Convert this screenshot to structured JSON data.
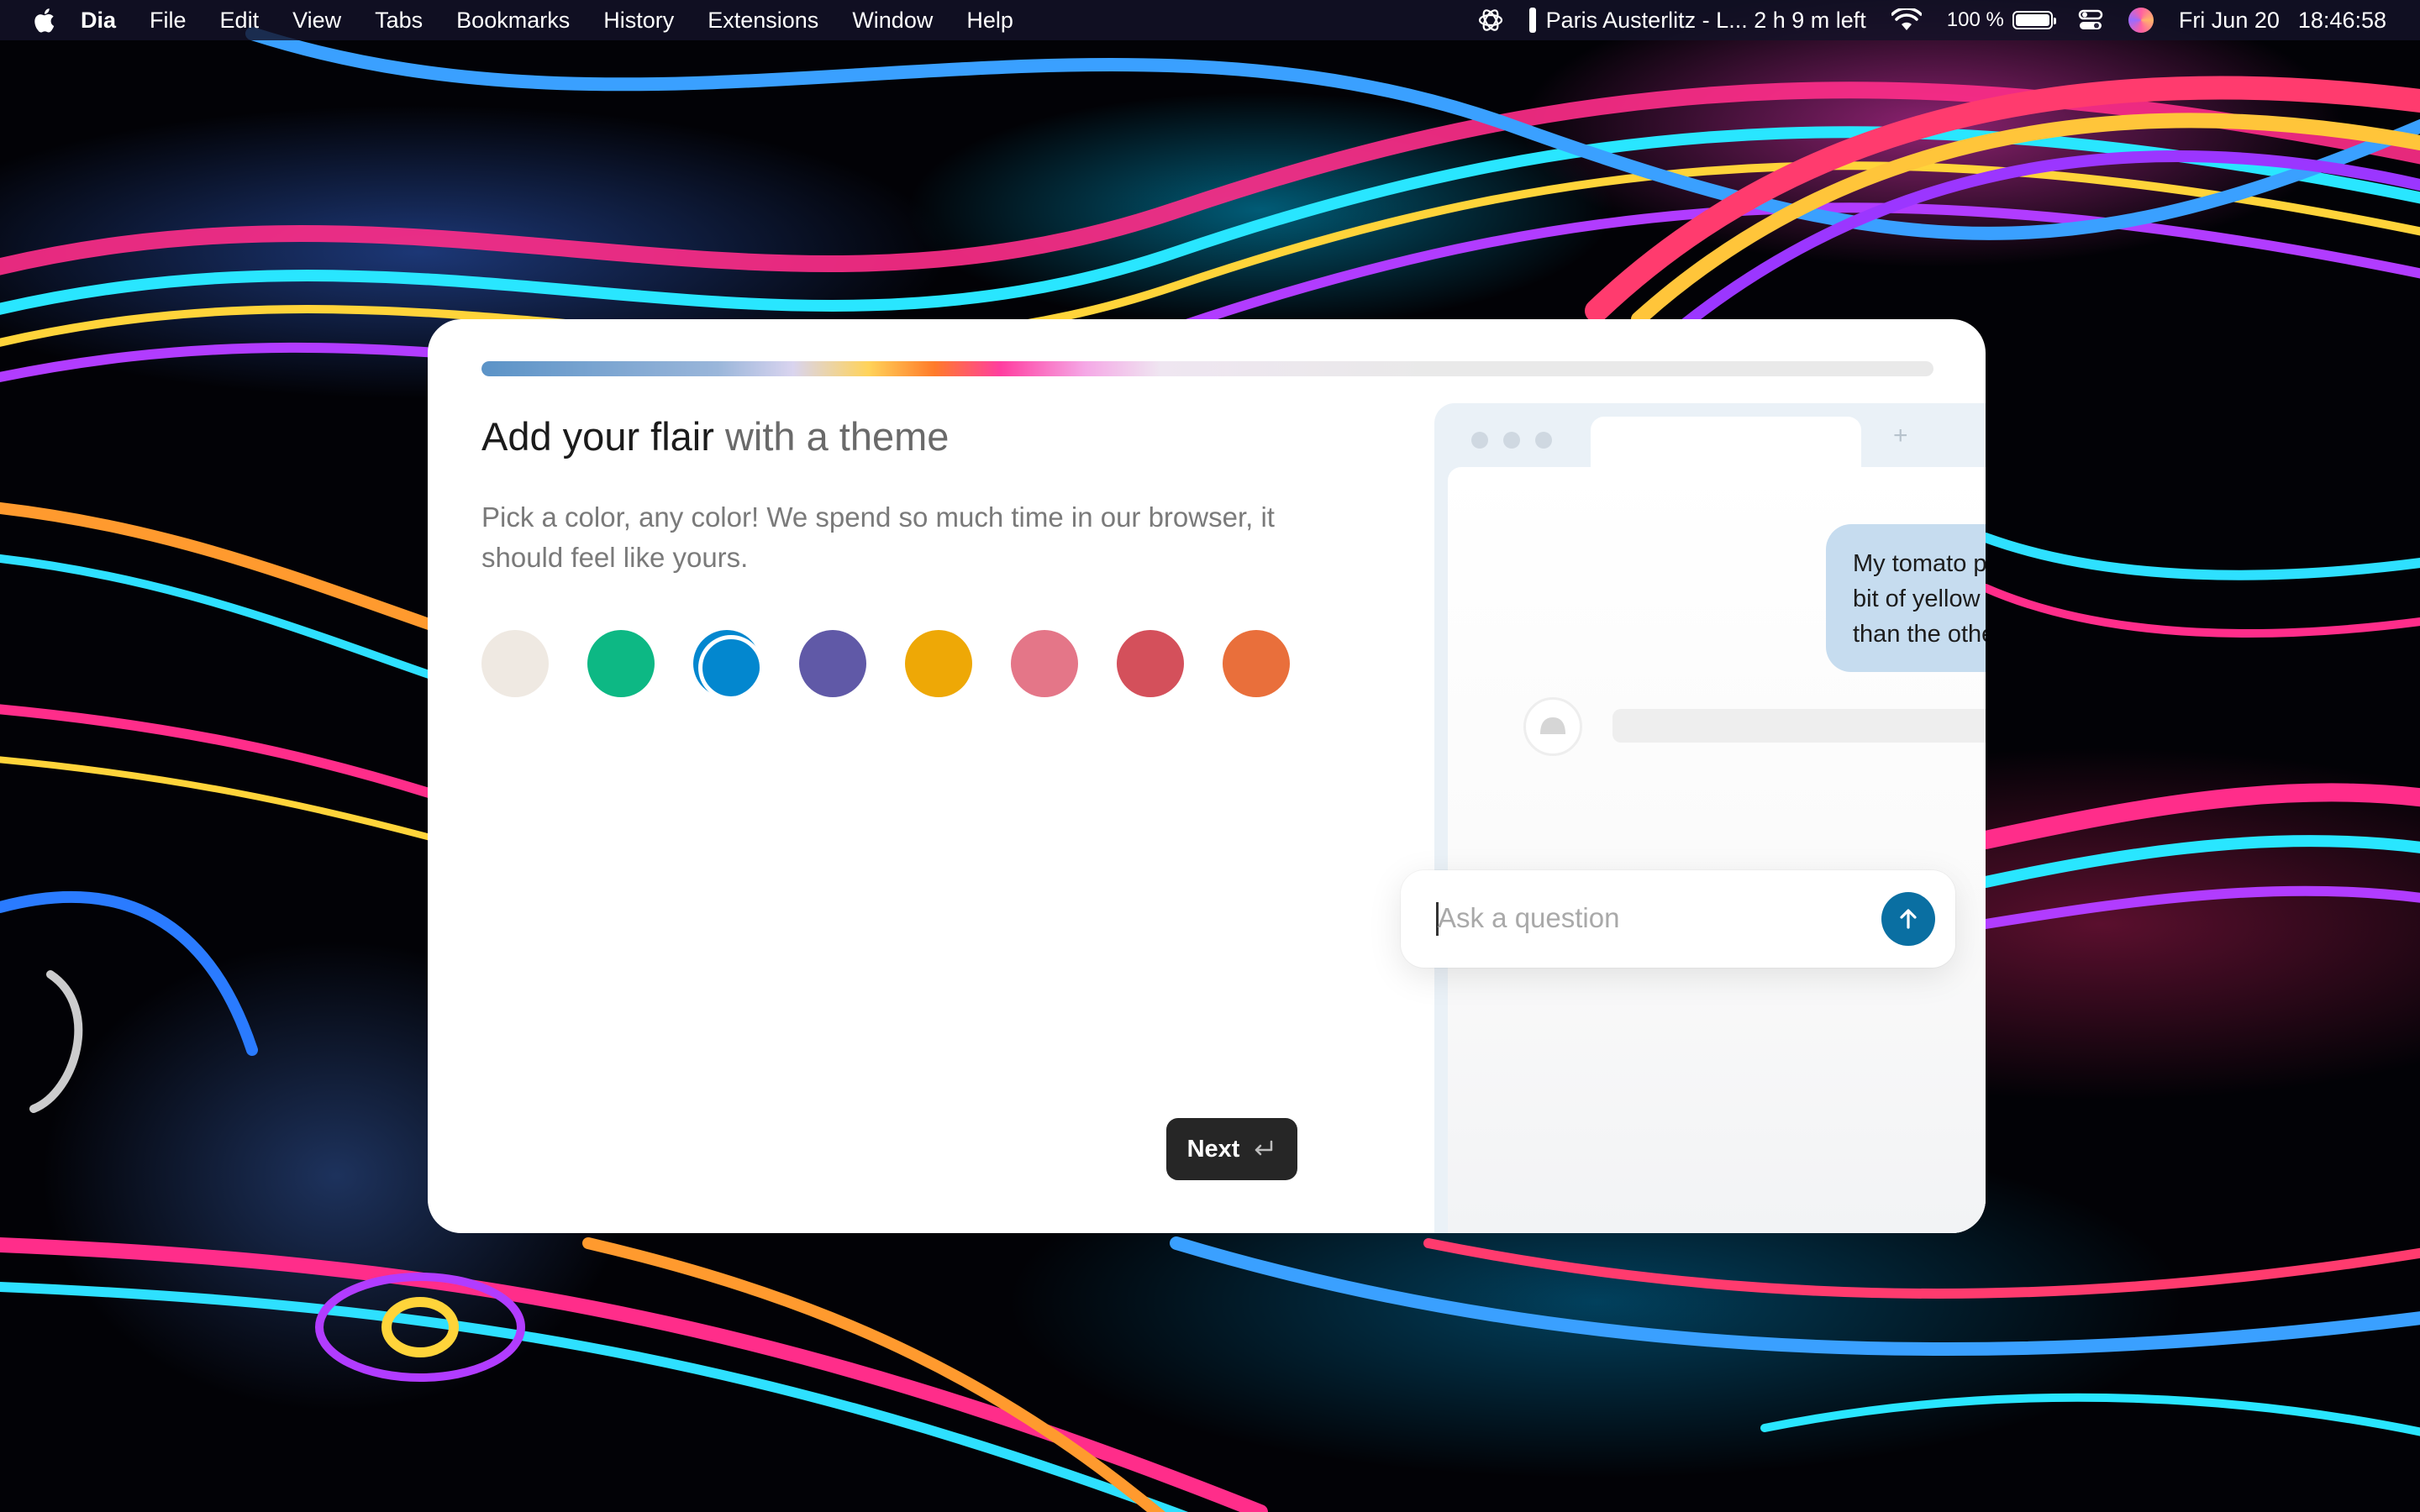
{
  "menubar": {
    "app_name": "Dia",
    "menus": [
      "File",
      "Edit",
      "View",
      "Tabs",
      "Bookmarks",
      "History",
      "Extensions",
      "Window",
      "Help"
    ],
    "now_playing": "Paris Austerlitz - L... 2 h 9 m left",
    "battery_percent": "100 %",
    "battery_level": 1.0,
    "date": "Fri Jun 20",
    "time": "18:46:58"
  },
  "onboarding": {
    "progress": 0.65,
    "title_main": "Add your flair",
    "title_rest": " with a theme",
    "subtitle": "Pick a color, any color! We spend so much time in our browser, it should feel like yours.",
    "swatches": [
      {
        "name": "cream",
        "color": "#efe9e2",
        "selected": false
      },
      {
        "name": "green",
        "color": "#0db884",
        "selected": false
      },
      {
        "name": "blue",
        "color": "#0387cf",
        "selected": true
      },
      {
        "name": "purple",
        "color": "#6059a7",
        "selected": false
      },
      {
        "name": "yellow",
        "color": "#eea806",
        "selected": false
      },
      {
        "name": "pink",
        "color": "#e47688",
        "selected": false
      },
      {
        "name": "red",
        "color": "#d4505b",
        "selected": false
      },
      {
        "name": "orange",
        "color": "#e96f3b",
        "selected": false
      }
    ],
    "next_label": "Next",
    "next_icon": "return-key-icon"
  },
  "preview": {
    "new_tab_symbol": "+",
    "message_lines": [
      "My tomato p",
      "bit of yellow",
      "than the othe"
    ],
    "ask_placeholder": "Ask a question",
    "accent_color": "#0a6fa2"
  }
}
